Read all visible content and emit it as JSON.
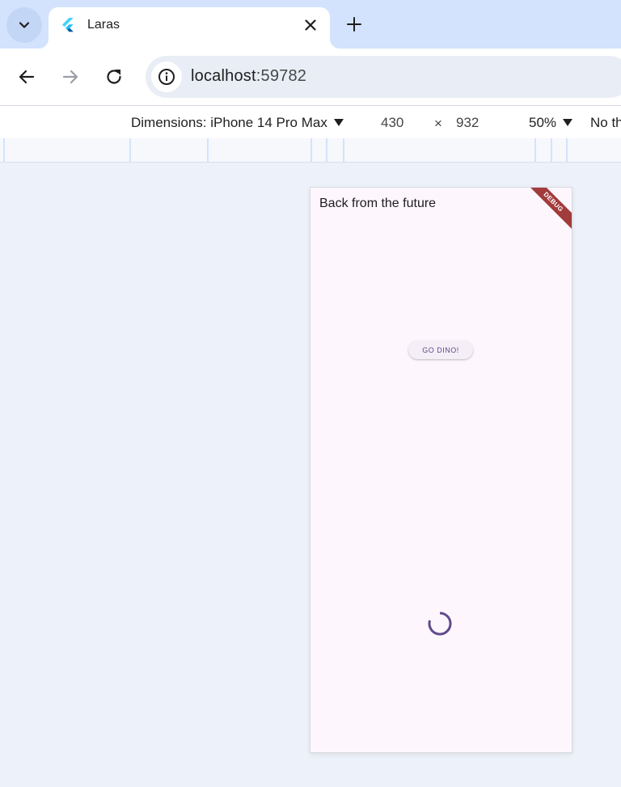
{
  "browser": {
    "tab": {
      "title": "Laras"
    },
    "address": {
      "host": "localhost",
      "port": ":59782"
    }
  },
  "devtools": {
    "dimensions_label": "Dimensions: iPhone 14 Pro Max",
    "width": "430",
    "times": "×",
    "height": "932",
    "zoom": "50%",
    "throttle_label": "No th"
  },
  "app": {
    "title": "Back from the future",
    "debug_banner": "DEBUG",
    "button_label": "GO DINO!"
  },
  "colors": {
    "tabstrip": "#d3e3fd",
    "accent": "#5f4b8b",
    "debug": "#a23b3b"
  }
}
